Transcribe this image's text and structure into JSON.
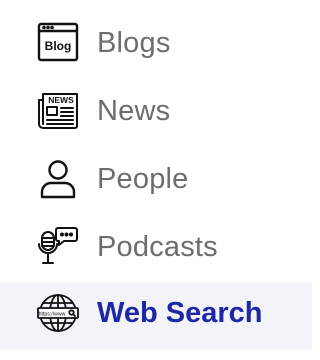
{
  "menu": {
    "items": [
      {
        "label": "Blogs",
        "icon": "blog-icon",
        "active": false
      },
      {
        "label": "News",
        "icon": "newspaper-icon",
        "active": false
      },
      {
        "label": "People",
        "icon": "person-icon",
        "active": false
      },
      {
        "label": "Podcasts",
        "icon": "podcast-microphone-icon",
        "active": false
      },
      {
        "label": "Web Search",
        "icon": "globe-search-icon",
        "active": true
      }
    ],
    "blog_icon_text": "Blog",
    "news_icon_text": "NEWS",
    "web_icon_text": "https://www"
  },
  "colors": {
    "label": "#6d6d6d",
    "active_label": "#1f27a6",
    "active_background": "#f2f4fa",
    "icon_stroke": "#111111"
  }
}
